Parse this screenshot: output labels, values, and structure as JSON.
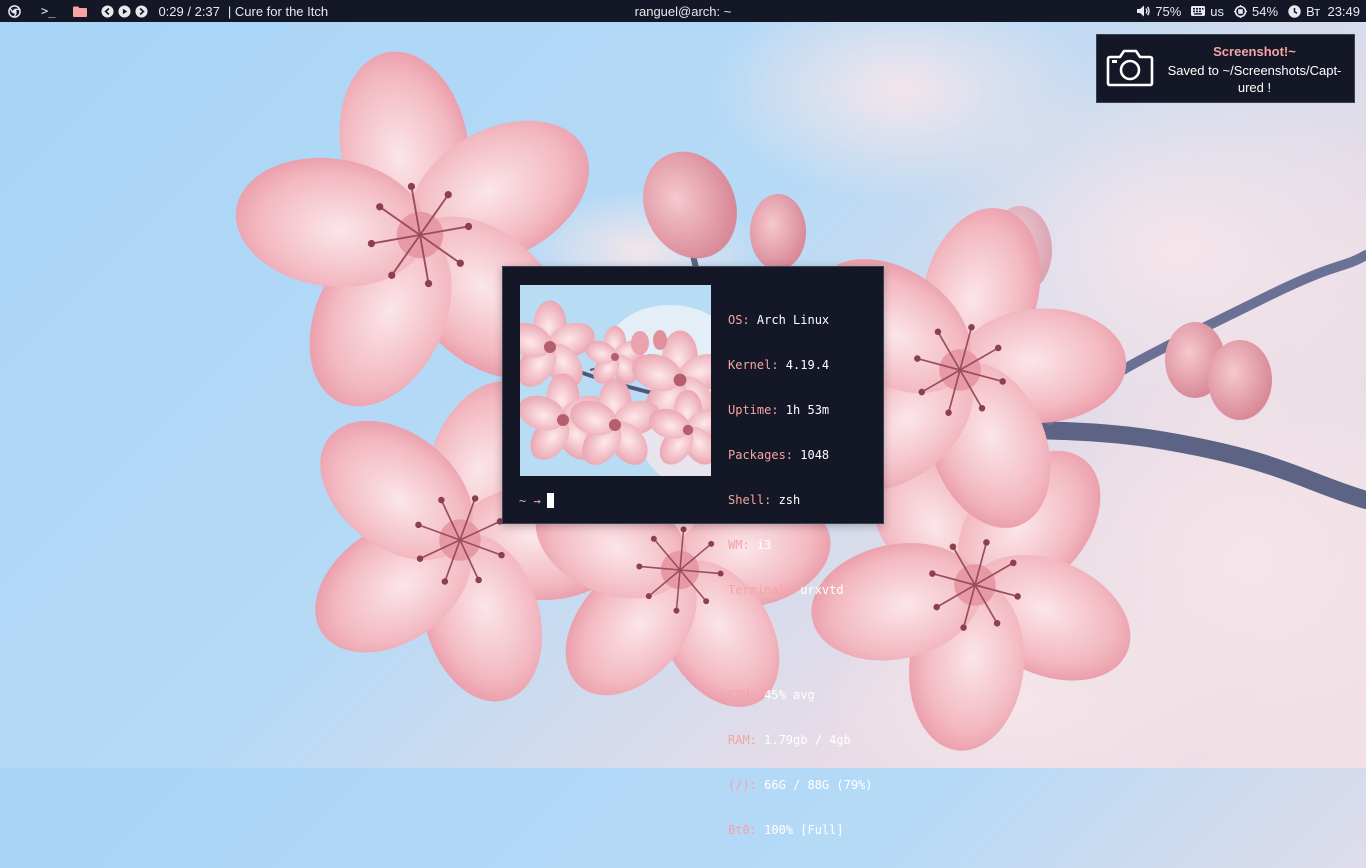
{
  "topbar": {
    "terminal_icon": ">_",
    "media_time": "0:29 / 2:37",
    "track_title": "| Cure for the Itch",
    "window_title": "ranguel@arch: ~",
    "volume": "75%",
    "keyboard_layout": "us",
    "cpu": "54%",
    "clock": "Вт  23:49",
    "icons": [
      "chrome-icon",
      "terminal-icon",
      "folder-icon",
      "previous-track-icon",
      "play-icon",
      "next-track-icon",
      "volume-icon",
      "keyboard-icon",
      "cpu-icon",
      "clock-icon"
    ]
  },
  "notification": {
    "title": "Screenshot!~",
    "body_line1": "Saved to ~/Screenshots/Capt-",
    "body_line2": "ured !",
    "icon": "camera-icon"
  },
  "terminal": {
    "info": [
      {
        "key": "OS:",
        "value": " Arch Linux"
      },
      {
        "key": "Kernel:",
        "value": " 4.19.4"
      },
      {
        "key": "Uptime:",
        "value": " 1h 53m"
      },
      {
        "key": "Packages:",
        "value": " 1048"
      },
      {
        "key": "Shell:",
        "value": " zsh"
      },
      {
        "key": "WM:",
        "value": " i3"
      },
      {
        "key": "Terminal:",
        "value": " urxvtd"
      }
    ],
    "stats": [
      {
        "key": "CPU:",
        "value": " 45% avg"
      },
      {
        "key": "RAM:",
        "value": " 1.79gb / 4gb"
      },
      {
        "key": "(/):",
        "value": " 66G / 88G (79%)"
      },
      {
        "key": "Bt0:",
        "value": " 100% [Full]"
      }
    ],
    "prompt": "~ →"
  },
  "colors": {
    "bar_bg": "#141826",
    "accent_pink": "#f5a3a3",
    "text": "#e8e8ee",
    "sky": "#a8d4f7",
    "blossom": "#f4bcc4"
  }
}
